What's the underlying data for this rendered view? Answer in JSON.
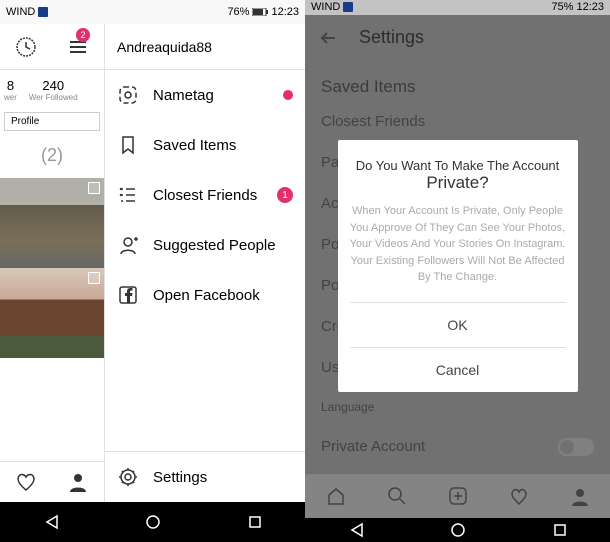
{
  "left": {
    "status": {
      "carrier": "WIND",
      "battery": "76%",
      "time": "12:23"
    },
    "sidebar": {
      "badge": "2",
      "stats": [
        {
          "num": "8",
          "label": "wer"
        },
        {
          "num": "240",
          "label": "Wer Followed"
        }
      ],
      "profile_label": "Profile",
      "post_count": "(2)"
    },
    "drawer": {
      "username": "Andreaquida88",
      "items": [
        {
          "label": "Nametag",
          "dot": true
        },
        {
          "label": "Saved Items"
        },
        {
          "label": "Closest Friends",
          "badge": "1"
        },
        {
          "label": "Suggested People"
        },
        {
          "label": "Open Facebook"
        }
      ],
      "footer_label": "Settings"
    }
  },
  "right": {
    "status": {
      "carrier": "WIND",
      "battery": "75%",
      "time": "12:23"
    },
    "header": {
      "title": "Settings"
    },
    "section1": "Saved Items",
    "items": [
      "Closest Friends",
      "Pay",
      "Activ",
      "Post",
      "Post",
      "Cron",
      "Use",
      "Language",
      "Private Account"
    ],
    "dialog": {
      "title_line1": "Do You Want To Make The Account",
      "title_line2": "Private?",
      "body": "When Your Account Is Private, Only People You Approve Of They Can See Your Photos, Your Videos And Your Stories On Instagram. Your Existing Followers Will Not Be Affected By The Change.",
      "ok": "OK",
      "cancel": "Cancel"
    }
  }
}
